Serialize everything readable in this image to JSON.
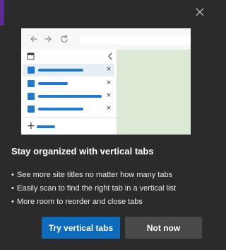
{
  "colors": {
    "background": "#2b2b2b",
    "accent": "#5c2d91",
    "primary_button": "#0f6cbd",
    "secondary_button": "#494949",
    "illustration_tab": "#1f78d1",
    "illustration_content": "#dcead5"
  },
  "illustration": {
    "tabs": [
      {
        "close": "×",
        "selected": true
      },
      {
        "close": "×",
        "selected": false
      },
      {
        "close": "×",
        "selected": false
      },
      {
        "close": "×",
        "selected": false
      }
    ],
    "new_tab_glyph": "+"
  },
  "dialog": {
    "title": "Stay organized with vertical tabs",
    "bullets": [
      "See more site titles no matter how many tabs",
      "Easily scan to find the right tab in a vertical list",
      "More room to reorder and close tabs"
    ],
    "primary_button": "Try vertical tabs",
    "secondary_button": "Not now"
  }
}
